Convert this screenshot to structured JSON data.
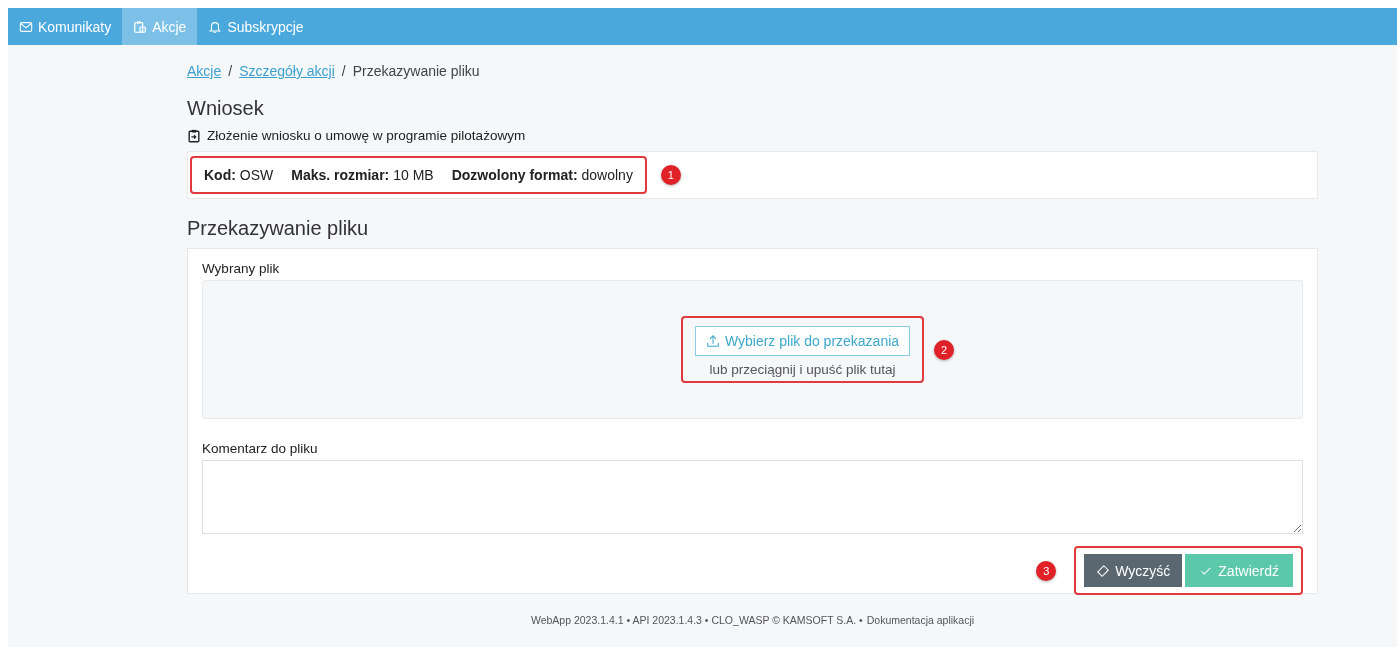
{
  "nav": {
    "items": [
      {
        "label": "Komunikaty",
        "selected": false
      },
      {
        "label": "Akcje",
        "selected": true
      },
      {
        "label": "Subskrypcje",
        "selected": false
      }
    ]
  },
  "breadcrumb": [
    {
      "label": "Akcje",
      "kind": "link"
    },
    {
      "label": "/",
      "kind": "separator"
    },
    {
      "label": "Szczegóły akcji",
      "kind": "link"
    },
    {
      "label": "/",
      "kind": "separator"
    },
    {
      "label": "Przekazywanie pliku",
      "kind": "current"
    }
  ],
  "request": {
    "title": "Wniosek",
    "description": "Złożenie wniosku o umowę w programie pilotażowym",
    "info": [
      {
        "label": "Kod:",
        "value": "OSW"
      },
      {
        "label": "Maks. rozmiar:",
        "value": "10 MB"
      },
      {
        "label": "Dozwolony format:",
        "value": "dowolny"
      }
    ],
    "marker": "1"
  },
  "upload": {
    "title": "Przekazywanie pliku",
    "file_label": "Wybrany plik",
    "choose_button": "Wybierz plik do przekazania",
    "drop_hint": "lub przeciągnij i upuść plik tutaj",
    "marker": "2",
    "comment_label": "Komentarz do pliku",
    "buttons": [
      {
        "label": "Wyczyść",
        "kind": "clear"
      },
      {
        "label": "Zatwierdź",
        "kind": "submit"
      }
    ],
    "buttons_marker": "3"
  },
  "footer": {
    "text": "WebApp 2023.1.4.1 • API 2023.1.4.3 • CLO_WASP © KAMSOFT S.A. •",
    "link": "Dokumentacja aplikacji"
  }
}
